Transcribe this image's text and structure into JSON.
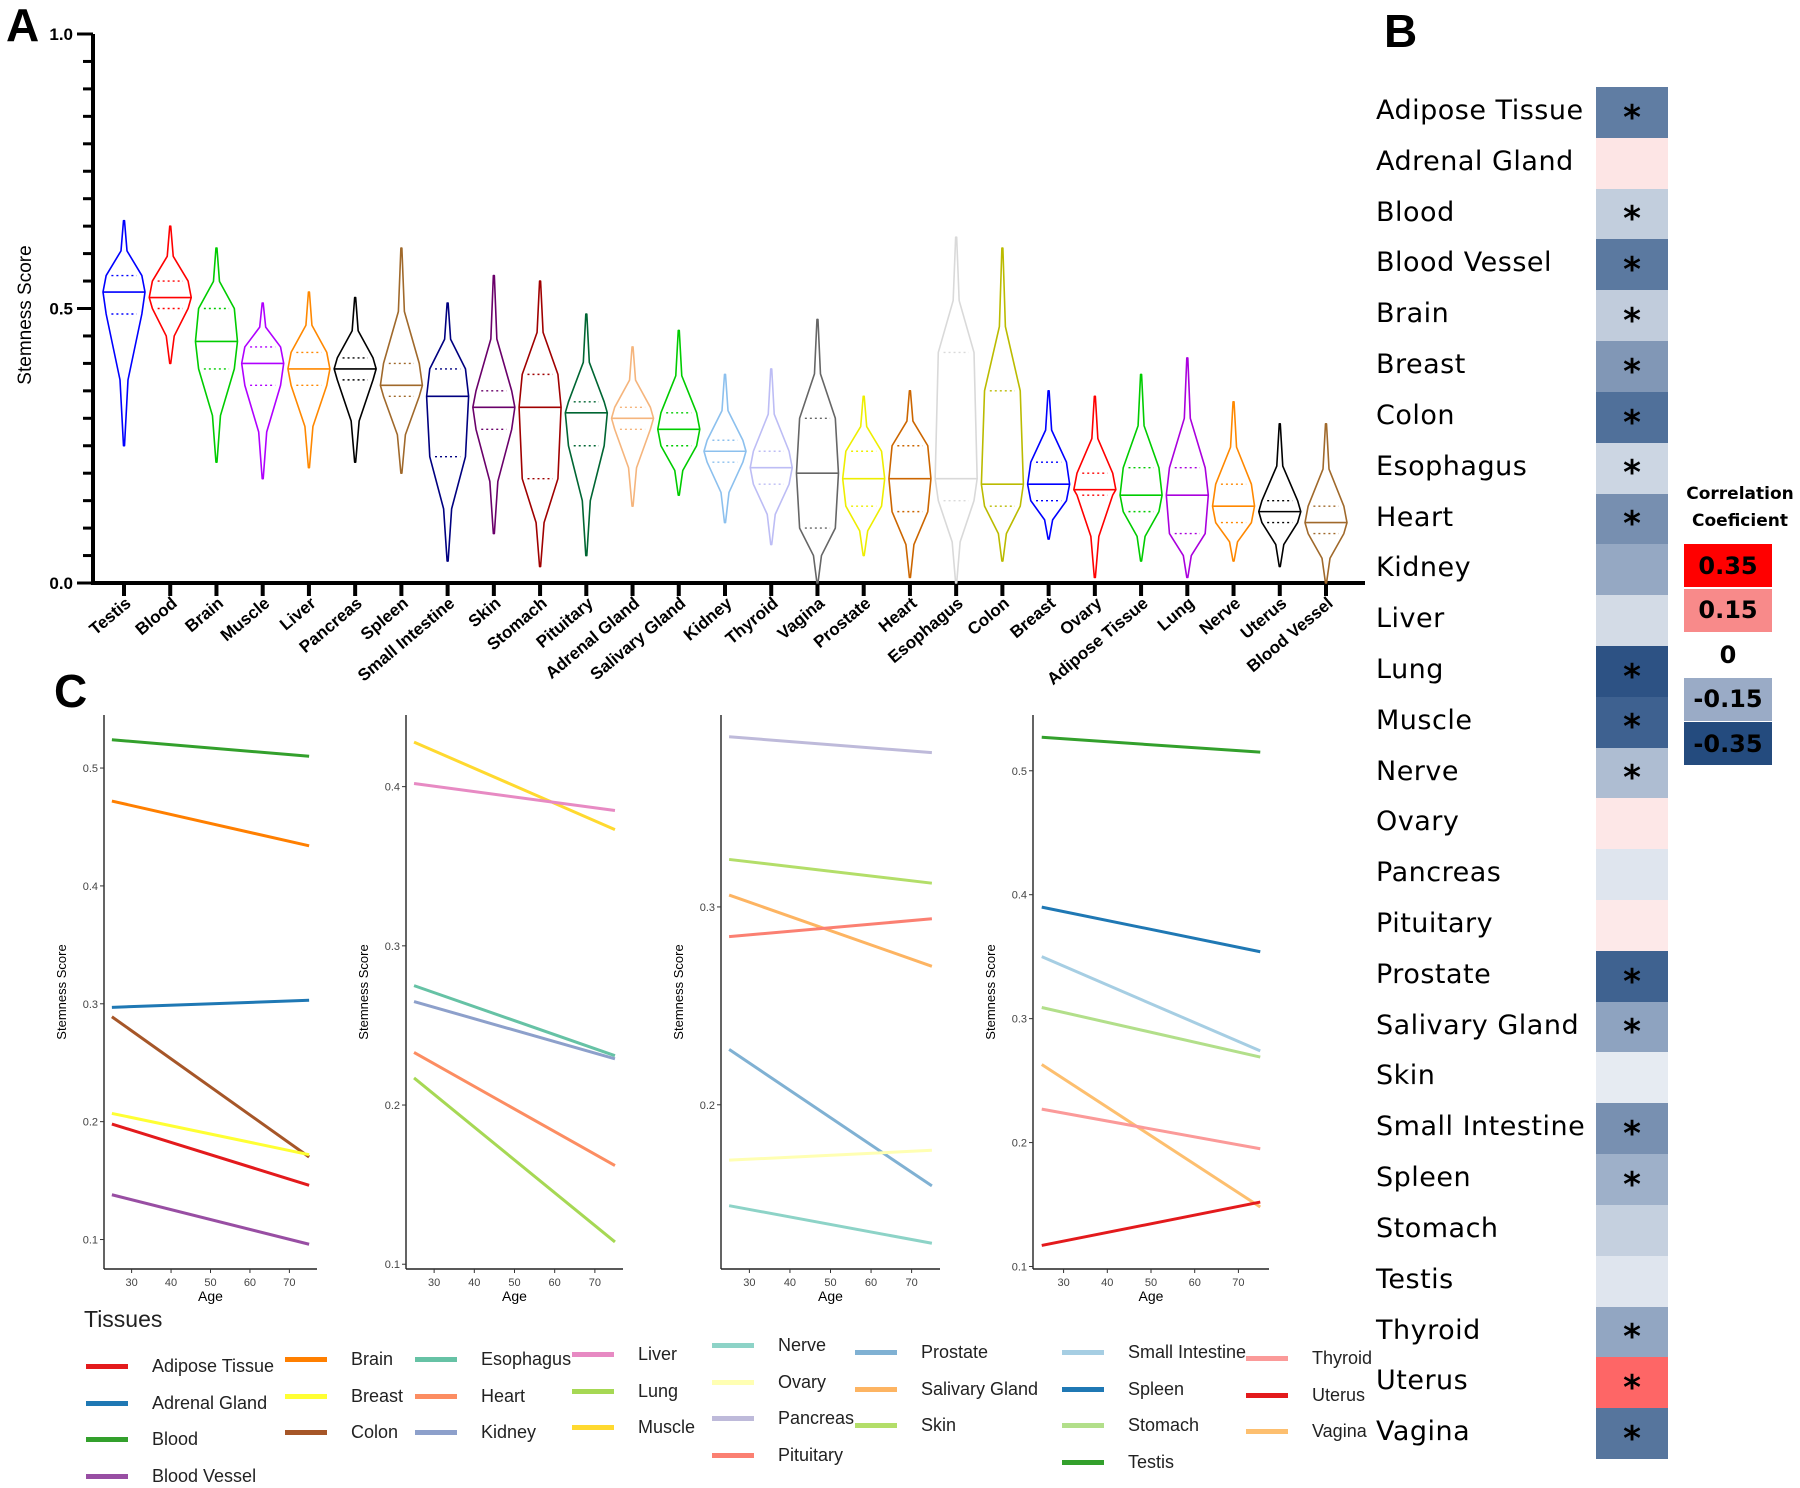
{
  "panels": {
    "a_label": "A",
    "b_label": "B",
    "c_label": "C"
  },
  "chart_data": [
    {
      "id": "panel-a",
      "type": "violin",
      "title": "",
      "xlabel": "",
      "ylabel": "Stemness Score",
      "ylim": [
        0.0,
        1.0
      ],
      "yticks": [
        "0.0",
        "0.5",
        "1.0"
      ],
      "minor_tick_step": 0.05,
      "categories": [
        "Testis",
        "Blood",
        "Brain",
        "Muscle",
        "Liver",
        "Pancreas",
        "Spleen",
        "Small Intestine",
        "Skin",
        "Stomach",
        "Pituitary",
        "Adrenal Gland",
        "Salivary Gland",
        "Kidney",
        "Thyroid",
        "Vagina",
        "Prostate",
        "Heart",
        "Esophagus",
        "Colon",
        "Breast",
        "Ovary",
        "Adipose Tissue",
        "Lung",
        "Nerve",
        "Uterus",
        "Blood Vessel"
      ],
      "series": [
        {
          "name": "Testis",
          "color": "#0000ff",
          "min": 0.25,
          "q1": 0.49,
          "median": 0.53,
          "q3": 0.56,
          "max": 0.66
        },
        {
          "name": "Blood",
          "color": "#ff0000",
          "min": 0.4,
          "q1": 0.5,
          "median": 0.52,
          "q3": 0.55,
          "max": 0.65
        },
        {
          "name": "Brain",
          "color": "#00cc00",
          "min": 0.22,
          "q1": 0.39,
          "median": 0.44,
          "q3": 0.5,
          "max": 0.61
        },
        {
          "name": "Muscle",
          "color": "#b000ff",
          "min": 0.19,
          "q1": 0.36,
          "median": 0.4,
          "q3": 0.43,
          "max": 0.51
        },
        {
          "name": "Liver",
          "color": "#ff8800",
          "min": 0.21,
          "q1": 0.36,
          "median": 0.39,
          "q3": 0.42,
          "max": 0.53
        },
        {
          "name": "Pancreas",
          "color": "#000000",
          "min": 0.22,
          "q1": 0.37,
          "median": 0.39,
          "q3": 0.41,
          "max": 0.52
        },
        {
          "name": "Spleen",
          "color": "#a0692b",
          "min": 0.2,
          "q1": 0.34,
          "median": 0.36,
          "q3": 0.4,
          "max": 0.61
        },
        {
          "name": "Small Intestine",
          "color": "#000080",
          "min": 0.04,
          "q1": 0.23,
          "median": 0.34,
          "q3": 0.39,
          "max": 0.51
        },
        {
          "name": "Skin",
          "color": "#6a006a",
          "min": 0.09,
          "q1": 0.28,
          "median": 0.32,
          "q3": 0.35,
          "max": 0.56
        },
        {
          "name": "Stomach",
          "color": "#a00000",
          "min": 0.03,
          "q1": 0.19,
          "median": 0.32,
          "q3": 0.38,
          "max": 0.55
        },
        {
          "name": "Pituitary",
          "color": "#006633",
          "min": 0.05,
          "q1": 0.25,
          "median": 0.31,
          "q3": 0.33,
          "max": 0.49
        },
        {
          "name": "Adrenal Gland",
          "color": "#f5b57d",
          "min": 0.14,
          "q1": 0.28,
          "median": 0.3,
          "q3": 0.32,
          "max": 0.43
        },
        {
          "name": "Salivary Gland",
          "color": "#00cc00",
          "min": 0.16,
          "q1": 0.25,
          "median": 0.28,
          "q3": 0.31,
          "max": 0.46
        },
        {
          "name": "Kidney",
          "color": "#8cc0ee",
          "min": 0.11,
          "q1": 0.22,
          "median": 0.24,
          "q3": 0.26,
          "max": 0.38
        },
        {
          "name": "Thyroid",
          "color": "#bdbdf5",
          "min": 0.07,
          "q1": 0.18,
          "median": 0.21,
          "q3": 0.24,
          "max": 0.39
        },
        {
          "name": "Vagina",
          "color": "#666666",
          "min": 0.0,
          "q1": 0.1,
          "median": 0.2,
          "q3": 0.3,
          "max": 0.48
        },
        {
          "name": "Prostate",
          "color": "#eeee00",
          "min": 0.05,
          "q1": 0.14,
          "median": 0.19,
          "q3": 0.24,
          "max": 0.34
        },
        {
          "name": "Heart",
          "color": "#cc6600",
          "min": 0.01,
          "q1": 0.13,
          "median": 0.19,
          "q3": 0.25,
          "max": 0.35
        },
        {
          "name": "Esophagus",
          "color": "#d9d9d9",
          "min": 0.0,
          "q1": 0.15,
          "median": 0.19,
          "q3": 0.42,
          "max": 0.63
        },
        {
          "name": "Colon",
          "color": "#bbbb00",
          "min": 0.04,
          "q1": 0.14,
          "median": 0.18,
          "q3": 0.35,
          "max": 0.61
        },
        {
          "name": "Breast",
          "color": "#0000ff",
          "min": 0.08,
          "q1": 0.15,
          "median": 0.18,
          "q3": 0.22,
          "max": 0.35
        },
        {
          "name": "Ovary",
          "color": "#ff0000",
          "min": 0.01,
          "q1": 0.16,
          "median": 0.17,
          "q3": 0.2,
          "max": 0.34
        },
        {
          "name": "Adipose Tissue",
          "color": "#00cc00",
          "min": 0.04,
          "q1": 0.13,
          "median": 0.16,
          "q3": 0.21,
          "max": 0.38
        },
        {
          "name": "Lung",
          "color": "#aa00dd",
          "min": 0.01,
          "q1": 0.09,
          "median": 0.16,
          "q3": 0.21,
          "max": 0.41
        },
        {
          "name": "Nerve",
          "color": "#ff8800",
          "min": 0.04,
          "q1": 0.11,
          "median": 0.14,
          "q3": 0.18,
          "max": 0.33
        },
        {
          "name": "Uterus",
          "color": "#000000",
          "min": 0.03,
          "q1": 0.11,
          "median": 0.13,
          "q3": 0.15,
          "max": 0.29
        },
        {
          "name": "Blood Vessel",
          "color": "#a0692b",
          "min": 0.0,
          "q1": 0.09,
          "median": 0.11,
          "q3": 0.14,
          "max": 0.29
        }
      ]
    },
    {
      "id": "panel-b",
      "type": "heatmap",
      "title": "",
      "legend_title": [
        "Correlation",
        "Coeficient"
      ],
      "legend_placement": "right",
      "legend_scale": [
        {
          "label": "0.35",
          "color": "#ff0000"
        },
        {
          "label": "0.15",
          "color": "#f88a8a"
        },
        {
          "label": "0",
          "color": "#ffffff"
        },
        {
          "label": "-0.15",
          "color": "#9aabc6"
        },
        {
          "label": "-0.35",
          "color": "#244b7e"
        }
      ],
      "significance_marker": "*",
      "rows": [
        {
          "tissue": "Adipose Tissue",
          "color": "#607da3",
          "significant": true
        },
        {
          "tissue": "Adrenal Gland",
          "color": "#fde5e5",
          "significant": false
        },
        {
          "tissue": "Blood",
          "color": "#c2cedd",
          "significant": true
        },
        {
          "tissue": "Blood Vessel",
          "color": "#5b79a0",
          "significant": true
        },
        {
          "tissue": "Brain",
          "color": "#c1ccdc",
          "significant": true
        },
        {
          "tissue": "Breast",
          "color": "#8197b6",
          "significant": true
        },
        {
          "tissue": "Colon",
          "color": "#50709a",
          "significant": true
        },
        {
          "tissue": "Esophagus",
          "color": "#ccd6e3",
          "significant": true
        },
        {
          "tissue": "Heart",
          "color": "#778fb0",
          "significant": true
        },
        {
          "tissue": "Kidney",
          "color": "#95a8c3",
          "significant": false
        },
        {
          "tissue": "Liver",
          "color": "#d3dbe6",
          "significant": false
        },
        {
          "tissue": "Lung",
          "color": "#2d5284",
          "significant": true
        },
        {
          "tissue": "Muscle",
          "color": "#3e6190",
          "significant": true
        },
        {
          "tissue": "Nerve",
          "color": "#aebdd2",
          "significant": true
        },
        {
          "tissue": "Ovary",
          "color": "#fde7e7",
          "significant": false
        },
        {
          "tissue": "Pancreas",
          "color": "#dfe5ee",
          "significant": false
        },
        {
          "tissue": "Pituitary",
          "color": "#fde9e9",
          "significant": false
        },
        {
          "tissue": "Prostate",
          "color": "#3f6290",
          "significant": true
        },
        {
          "tissue": "Salivary Gland",
          "color": "#8ea3c0",
          "significant": true
        },
        {
          "tissue": "Skin",
          "color": "#e6ebf2",
          "significant": false
        },
        {
          "tissue": "Small Intestine",
          "color": "#7890b1",
          "significant": true
        },
        {
          "tissue": "Spleen",
          "color": "#9eb0c9",
          "significant": true
        },
        {
          "tissue": "Stomach",
          "color": "#c5d0df",
          "significant": false
        },
        {
          "tissue": "Testis",
          "color": "#dfe5ee",
          "significant": false
        },
        {
          "tissue": "Thyroid",
          "color": "#92a6c2",
          "significant": true
        },
        {
          "tissue": "Uterus",
          "color": "#fe6666",
          "significant": true
        },
        {
          "tissue": "Vagina",
          "color": "#56759d",
          "significant": true
        }
      ]
    },
    {
      "id": "panel-c1",
      "type": "line",
      "xlabel": "Age",
      "ylabel": "Stemness Score",
      "xlim": [
        23,
        77
      ],
      "ylim": [
        0.075,
        0.545
      ],
      "xticks": [
        30,
        40,
        50,
        60,
        70
      ],
      "yticks": [
        0.1,
        0.2,
        0.3,
        0.4,
        0.5
      ],
      "x": [
        25,
        75
      ],
      "series": [
        {
          "name": "Blood",
          "color": "#33a02c",
          "values": [
            0.524,
            0.51
          ]
        },
        {
          "name": "Brain",
          "color": "#ff7f00",
          "values": [
            0.472,
            0.434
          ]
        },
        {
          "name": "Adrenal Gland",
          "color": "#1f78b4",
          "values": [
            0.297,
            0.303
          ]
        },
        {
          "name": "Colon",
          "color": "#a65628",
          "values": [
            0.289,
            0.17
          ]
        },
        {
          "name": "Breast",
          "color": "#ffff33",
          "values": [
            0.207,
            0.172
          ]
        },
        {
          "name": "Adipose Tissue",
          "color": "#e31a1c",
          "values": [
            0.198,
            0.146
          ]
        },
        {
          "name": "Blood Vessel",
          "color": "#984ea3",
          "values": [
            0.138,
            0.096
          ]
        }
      ]
    },
    {
      "id": "panel-c2",
      "type": "line",
      "xlabel": "Age",
      "ylabel": "Stemness Score",
      "xlim": [
        23,
        77
      ],
      "ylim": [
        0.097,
        0.445
      ],
      "xticks": [
        30,
        40,
        50,
        60,
        70
      ],
      "yticks": [
        0.1,
        0.2,
        0.3,
        0.4
      ],
      "x": [
        25,
        75
      ],
      "series": [
        {
          "name": "Muscle",
          "color": "#ffd92f",
          "values": [
            0.428,
            0.373
          ]
        },
        {
          "name": "Liver",
          "color": "#e78ac3",
          "values": [
            0.402,
            0.385
          ]
        },
        {
          "name": "Esophagus",
          "color": "#66c2a5",
          "values": [
            0.275,
            0.231
          ]
        },
        {
          "name": "Kidney",
          "color": "#8da0cb",
          "values": [
            0.265,
            0.229
          ]
        },
        {
          "name": "Heart",
          "color": "#fc8d62",
          "values": [
            0.233,
            0.162
          ]
        },
        {
          "name": "Lung",
          "color": "#a6d854",
          "values": [
            0.217,
            0.114
          ]
        }
      ]
    },
    {
      "id": "panel-c3",
      "type": "line",
      "xlabel": "Age",
      "ylabel": "Stemness Score",
      "xlim": [
        23,
        77
      ],
      "ylim": [
        0.117,
        0.397
      ],
      "xticks": [
        30,
        40,
        50,
        60,
        70
      ],
      "yticks": [
        0.2,
        0.3
      ],
      "x": [
        25,
        75
      ],
      "series": [
        {
          "name": "Pancreas",
          "color": "#bebada",
          "values": [
            0.386,
            0.378
          ]
        },
        {
          "name": "Skin",
          "color": "#b3de69",
          "values": [
            0.324,
            0.312
          ]
        },
        {
          "name": "Salivary Gland",
          "color": "#fdb462",
          "values": [
            0.306,
            0.27
          ]
        },
        {
          "name": "Pituitary",
          "color": "#fb8072",
          "values": [
            0.285,
            0.294
          ]
        },
        {
          "name": "Prostate",
          "color": "#80b1d3",
          "values": [
            0.228,
            0.159
          ]
        },
        {
          "name": "Ovary",
          "color": "#ffffb3",
          "values": [
            0.172,
            0.177
          ]
        },
        {
          "name": "Nerve",
          "color": "#8dd3c7",
          "values": [
            0.149,
            0.13
          ]
        }
      ]
    },
    {
      "id": "panel-c4",
      "type": "line",
      "xlabel": "Age",
      "ylabel": "Stemness Score",
      "xlim": [
        23,
        77
      ],
      "ylim": [
        0.098,
        0.545
      ],
      "xticks": [
        30,
        40,
        50,
        60,
        70
      ],
      "yticks": [
        0.1,
        0.2,
        0.3,
        0.4,
        0.5
      ],
      "x": [
        25,
        75
      ],
      "series": [
        {
          "name": "Testis",
          "color": "#33a02c",
          "values": [
            0.527,
            0.515
          ]
        },
        {
          "name": "Spleen",
          "color": "#1f78b4",
          "values": [
            0.39,
            0.354
          ]
        },
        {
          "name": "Small Intestine",
          "color": "#a6cee3",
          "values": [
            0.35,
            0.274
          ]
        },
        {
          "name": "Stomach",
          "color": "#b2df8a",
          "values": [
            0.309,
            0.269
          ]
        },
        {
          "name": "Vagina",
          "color": "#fdbf6f",
          "values": [
            0.263,
            0.148
          ]
        },
        {
          "name": "Thyroid",
          "color": "#fb9a99",
          "values": [
            0.227,
            0.195
          ]
        },
        {
          "name": "Uterus",
          "color": "#e31a1c",
          "values": [
            0.117,
            0.152
          ]
        }
      ]
    }
  ],
  "legend_c": {
    "title": "Tissues",
    "columns": [
      [
        {
          "name": "Adipose Tissue",
          "color": "#e31a1c"
        },
        {
          "name": "Adrenal Gland",
          "color": "#1f78b4"
        },
        {
          "name": "Blood",
          "color": "#33a02c"
        },
        {
          "name": "Blood Vessel",
          "color": "#984ea3"
        }
      ],
      [
        {
          "name": "Brain",
          "color": "#ff7f00"
        },
        {
          "name": "Breast",
          "color": "#ffff33"
        },
        {
          "name": "Colon",
          "color": "#a65628"
        }
      ],
      [
        {
          "name": "Esophagus",
          "color": "#66c2a5"
        },
        {
          "name": "Heart",
          "color": "#fc8d62"
        },
        {
          "name": "Kidney",
          "color": "#8da0cb"
        }
      ],
      [
        {
          "name": "Liver",
          "color": "#e78ac3"
        },
        {
          "name": "Lung",
          "color": "#a6d854"
        },
        {
          "name": "Muscle",
          "color": "#ffd92f"
        }
      ],
      [
        {
          "name": "Nerve",
          "color": "#8dd3c7"
        },
        {
          "name": "Ovary",
          "color": "#ffffb3"
        },
        {
          "name": "Pancreas",
          "color": "#bebada"
        },
        {
          "name": "Pituitary",
          "color": "#fb8072"
        }
      ],
      [
        {
          "name": "Prostate",
          "color": "#80b1d3"
        },
        {
          "name": "Salivary Gland",
          "color": "#fdb462"
        },
        {
          "name": "Skin",
          "color": "#b3de69"
        }
      ],
      [
        {
          "name": "Small Intestine",
          "color": "#a6cee3"
        },
        {
          "name": "Spleen",
          "color": "#1f78b4"
        },
        {
          "name": "Stomach",
          "color": "#b2df8a"
        },
        {
          "name": "Testis",
          "color": "#33a02c"
        }
      ],
      [
        {
          "name": "Thyroid",
          "color": "#fb9a99"
        },
        {
          "name": "Uterus",
          "color": "#e31a1c"
        },
        {
          "name": "Vagina",
          "color": "#fdbf6f"
        }
      ]
    ]
  }
}
